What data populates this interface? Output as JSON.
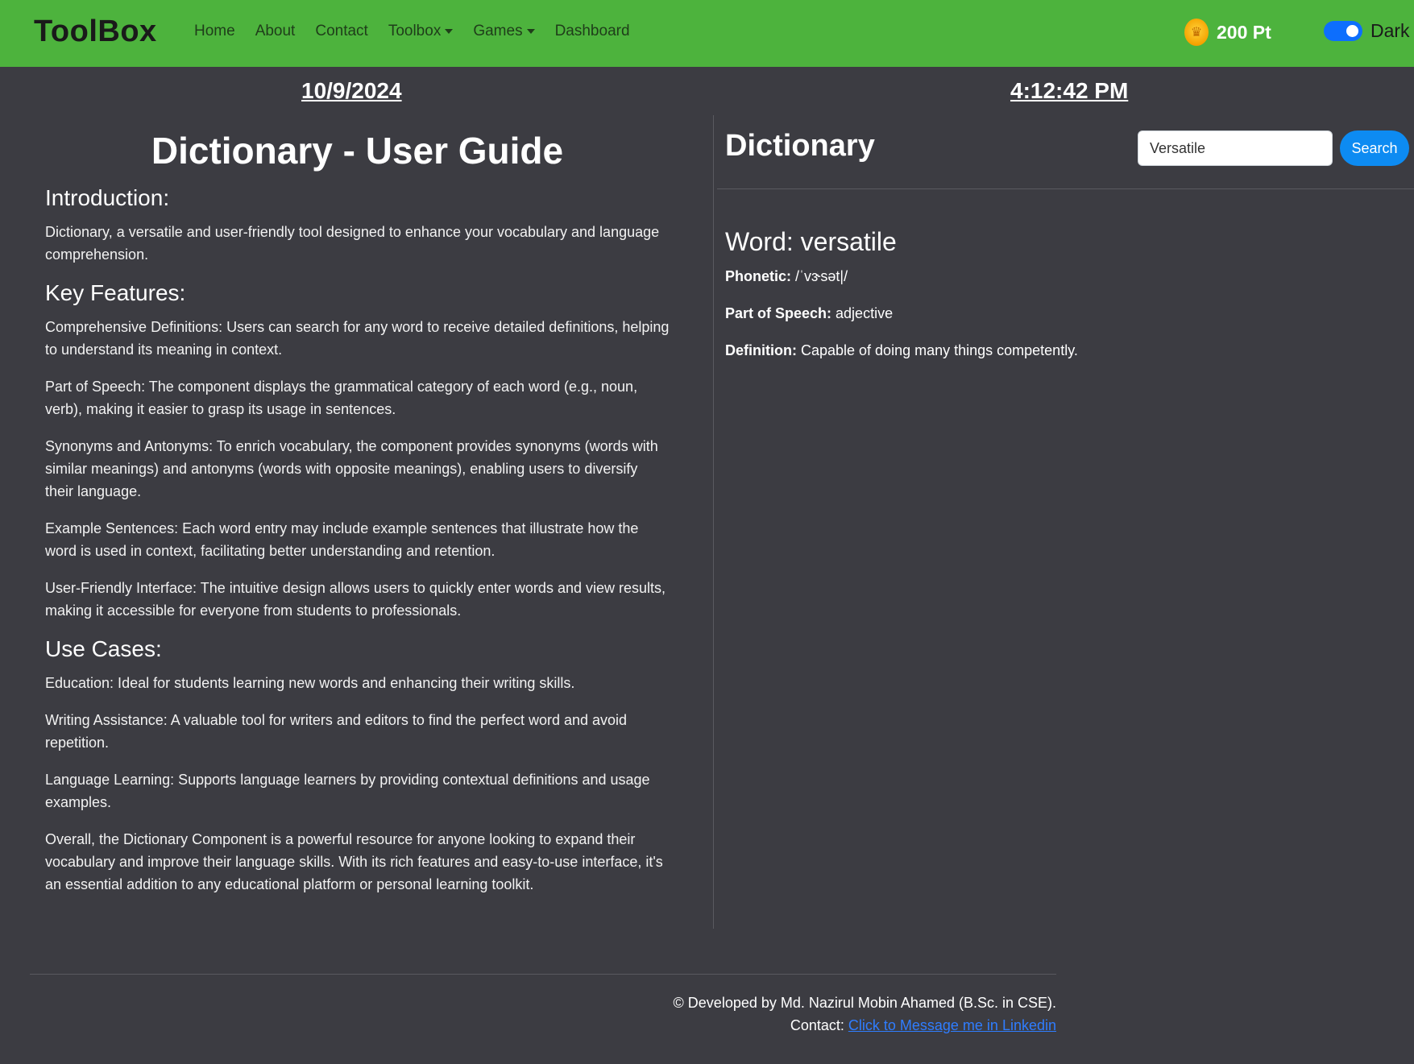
{
  "nav": {
    "brand": "ToolBox",
    "links": [
      "Home",
      "About",
      "Contact",
      "Toolbox",
      "Games",
      "Dashboard"
    ],
    "points": "200 Pt",
    "theme_label": "Dark",
    "theme_dark_enabled": true
  },
  "clock": {
    "date": "10/9/2024",
    "time": "4:12:42 PM"
  },
  "guide": {
    "title": "Dictionary - User Guide",
    "intro_heading": "Introduction:",
    "intro_text": "Dictionary, a versatile and user-friendly tool designed to enhance your vocabulary and language comprehension.",
    "features_heading": "Key Features:",
    "features": [
      "Comprehensive Definitions: Users can search for any word to receive detailed definitions, helping to understand its meaning in context.",
      "Part of Speech: The component displays the grammatical category of each word (e.g., noun, verb), making it easier to grasp its usage in sentences.",
      "Synonyms and Antonyms: To enrich vocabulary, the component provides synonyms (words with similar meanings) and antonyms (words with opposite meanings), enabling users to diversify their language.",
      "Example Sentences: Each word entry may include example sentences that illustrate how the word is used in context, facilitating better understanding and retention.",
      "User-Friendly Interface: The intuitive design allows users to quickly enter words and view results, making it accessible for everyone from students to professionals."
    ],
    "usecases_heading": "Use Cases:",
    "usecases": [
      "Education: Ideal for students learning new words and enhancing their writing skills.",
      "Writing Assistance: A valuable tool for writers and editors to find the perfect word and avoid repetition.",
      "Language Learning: Supports language learners by providing contextual definitions and usage examples."
    ],
    "conclusion": "Overall, the Dictionary Component is a powerful resource for anyone looking to expand their vocabulary and improve their language skills. With its rich features and easy-to-use interface, it's an essential addition to any educational platform or personal learning toolkit."
  },
  "dictionary": {
    "title": "Dictionary",
    "search_value": "Versatile",
    "search_button": "Search",
    "word_label": "Word: versatile",
    "phonetic_label": "Phonetic:",
    "phonetic_value": " /ˈvɝsət|/",
    "pos_label": "Part of Speech:",
    "pos_value": " adjective",
    "definition_label": "Definition:",
    "definition_value": " Capable of doing many things competently."
  },
  "footer": {
    "credit": "© Developed by Md. Nazirul Mobin Ahamed (B.Sc. in CSE).",
    "contact_label": "Contact: ",
    "contact_link": "Click to Message me in Linkedin"
  },
  "colors": {
    "navbar": "#4db33d",
    "background": "#3c3c42",
    "accent": "#0d8bf2",
    "coin": "#f5a300"
  }
}
